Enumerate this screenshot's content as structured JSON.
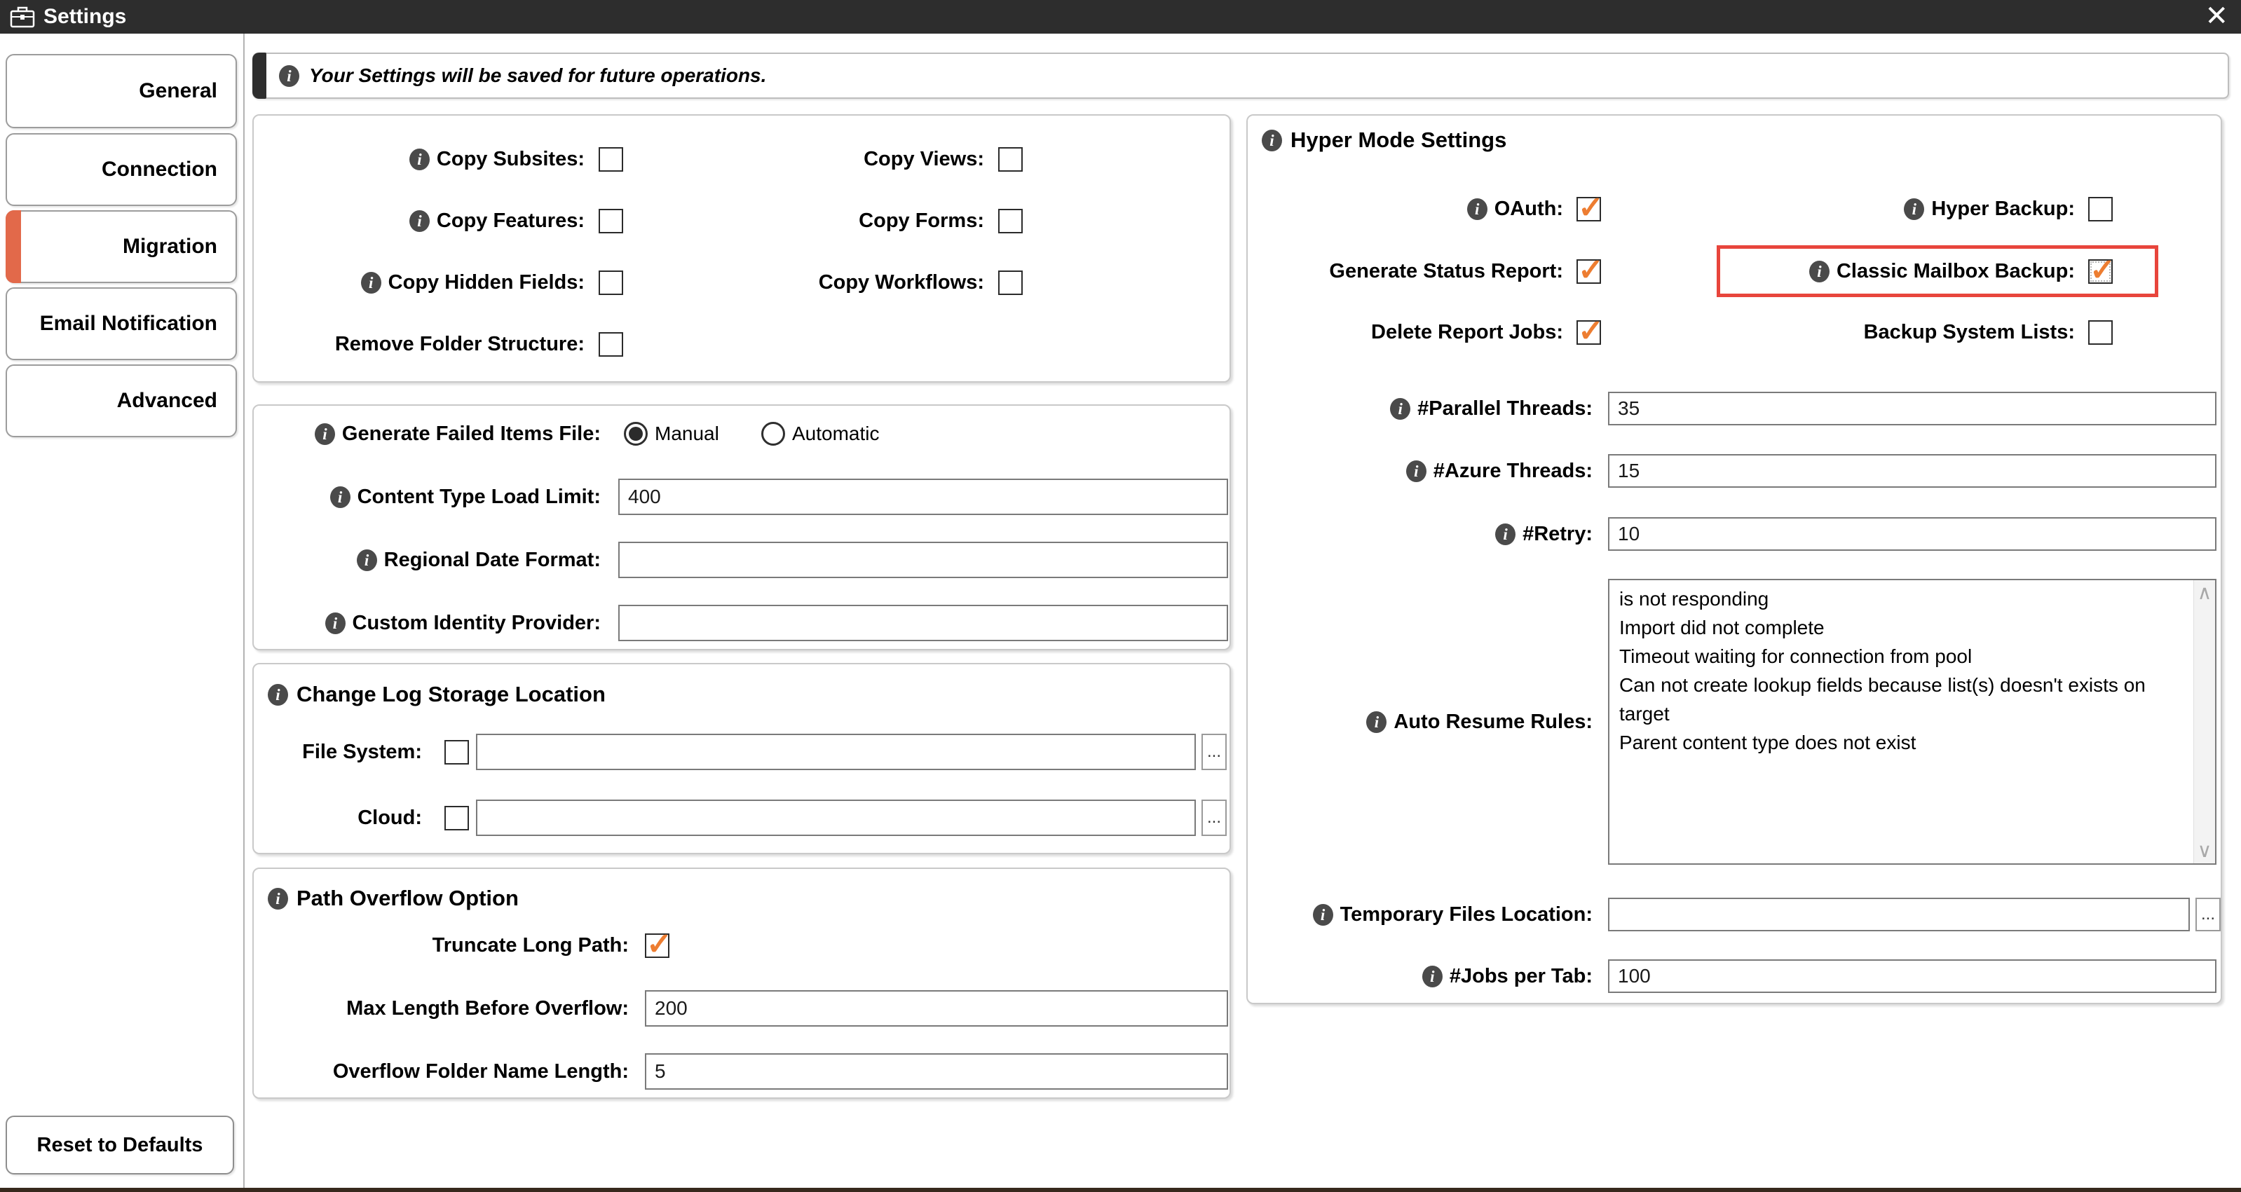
{
  "colors": {
    "titlebar": "#2d2d2d",
    "check_orange": "#ed7d31",
    "tab_accent_orange": "#e2694a",
    "highlight_red": "#e8453c"
  },
  "window": {
    "title": "Settings",
    "close_icon": "✕"
  },
  "banner": {
    "text": "Your Settings will be saved for future operations."
  },
  "sidebar": {
    "tabs": [
      {
        "label": "General",
        "active": false
      },
      {
        "label": "Connection",
        "active": false
      },
      {
        "label": "Migration",
        "active": true
      },
      {
        "label": "Email Notification",
        "active": false
      },
      {
        "label": "Advanced",
        "active": false
      }
    ],
    "reset_button_label": "Reset to Defaults"
  },
  "copy_group": {
    "rows": [
      {
        "left": {
          "label": "Copy Subsites:",
          "info": true,
          "checked": false
        },
        "right": {
          "label": "Copy Views:",
          "checked": false
        }
      },
      {
        "left": {
          "label": "Copy Features:",
          "info": true,
          "checked": false
        },
        "right": {
          "label": "Copy Forms:",
          "checked": false
        }
      },
      {
        "left": {
          "label": "Copy Hidden Fields:",
          "info": true,
          "checked": false
        },
        "right": {
          "label": "Copy Workflows:",
          "checked": false
        }
      },
      {
        "left": {
          "label": "Remove Folder Structure:",
          "info": false,
          "checked": false
        }
      }
    ]
  },
  "failed_items_group": {
    "generate_label": "Generate Failed Items File:",
    "radios": [
      {
        "label": "Manual",
        "selected": true
      },
      {
        "label": "Automatic",
        "selected": false
      }
    ],
    "fields": [
      {
        "label": "Content Type Load Limit:",
        "value": "400"
      },
      {
        "label": "Regional Date Format:",
        "value": ""
      },
      {
        "label": "Custom Identity Provider:",
        "value": ""
      }
    ]
  },
  "changelog_group": {
    "title": "Change Log Storage Location",
    "rows": [
      {
        "label": "File System:",
        "checked": false,
        "value": "",
        "browse": "..."
      },
      {
        "label": "Cloud:",
        "checked": false,
        "value": "",
        "browse": "..."
      }
    ]
  },
  "overflow_group": {
    "title": "Path Overflow Option",
    "truncate": {
      "label": "Truncate Long Path:",
      "checked": true
    },
    "fields": [
      {
        "label": "Max Length Before Overflow:",
        "value": "200"
      },
      {
        "label": "Overflow Folder Name Length:",
        "value": "5"
      }
    ]
  },
  "hyper_group": {
    "title": "Hyper Mode Settings",
    "checks": {
      "oauth": {
        "label": "OAuth:",
        "info": true,
        "checked": true
      },
      "hyper_backup": {
        "label": "Hyper Backup:",
        "info": true,
        "checked": false
      },
      "generate_status_report": {
        "label": "Generate Status Report:",
        "checked": true
      },
      "classic_mailbox_backup": {
        "label": "Classic Mailbox Backup:",
        "info": true,
        "checked": true,
        "highlighted": true
      },
      "delete_report_jobs": {
        "label": "Delete Report Jobs:",
        "checked": true
      },
      "backup_system_lists": {
        "label": "Backup System Lists:",
        "checked": false
      }
    },
    "fields": [
      {
        "label": "#Parallel Threads:",
        "value": "35"
      },
      {
        "label": "#Azure Threads:",
        "value": "15"
      },
      {
        "label": "#Retry:",
        "value": "10"
      }
    ],
    "auto_resume": {
      "label": "Auto Resume Rules:",
      "value": "is not responding\nImport did not complete\nTimeout waiting for connection from pool\nCan not create lookup fields because list(s) doesn't exists on target\nParent content type does not exist"
    },
    "temp_files": {
      "label": "Temporary Files Location:",
      "value": "",
      "browse": "..."
    },
    "jobs_per_tab": {
      "label": "#Jobs per Tab:",
      "value": "100"
    }
  }
}
